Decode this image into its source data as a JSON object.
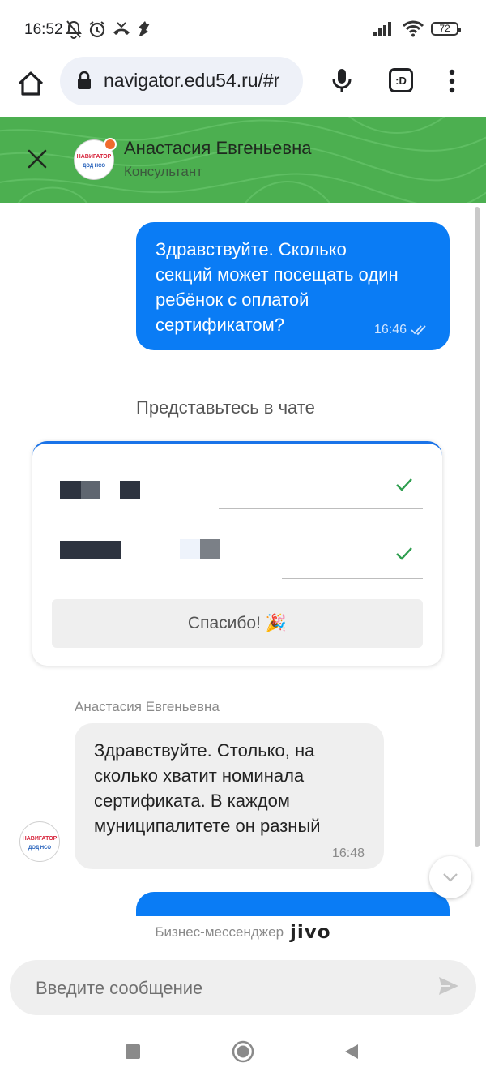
{
  "status_bar": {
    "time": "16:52",
    "battery": "72"
  },
  "browser": {
    "url": "navigator.edu54.ru/#r",
    "tabs_label": ":D"
  },
  "chat_header": {
    "agent_name": "Анастасия Евгеньевна",
    "agent_role": "Консультант",
    "header_color": "#4caf50"
  },
  "avatar": {
    "line1": "НАВИГАТОР",
    "line2": "ДОД НСО"
  },
  "messages": {
    "outgoing_1": {
      "text": "Здравствуйте. Сколько секций может посещать один ребёнок с оплатой сертификатом?",
      "time": "16:46"
    },
    "incoming_1": {
      "sender": "Анастасия Евгеньевна",
      "text": "Здравствуйте. Столько, на сколько хватит номинала сертификата. В каждом муниципалитете он разный",
      "time": "16:48"
    }
  },
  "intro_form": {
    "title": "Представьтесь в чате",
    "submit_label": "Спасибо!",
    "submit_emoji": "🎉"
  },
  "footer": {
    "powered_by": "Бизнес-мессенджер",
    "brand": "jivo",
    "input_placeholder": "Введите сообщение"
  },
  "colors": {
    "outgoing_bubble": "#0a7cf5",
    "incoming_bubble": "#efefef",
    "check_mark": "#2e9e4f"
  }
}
